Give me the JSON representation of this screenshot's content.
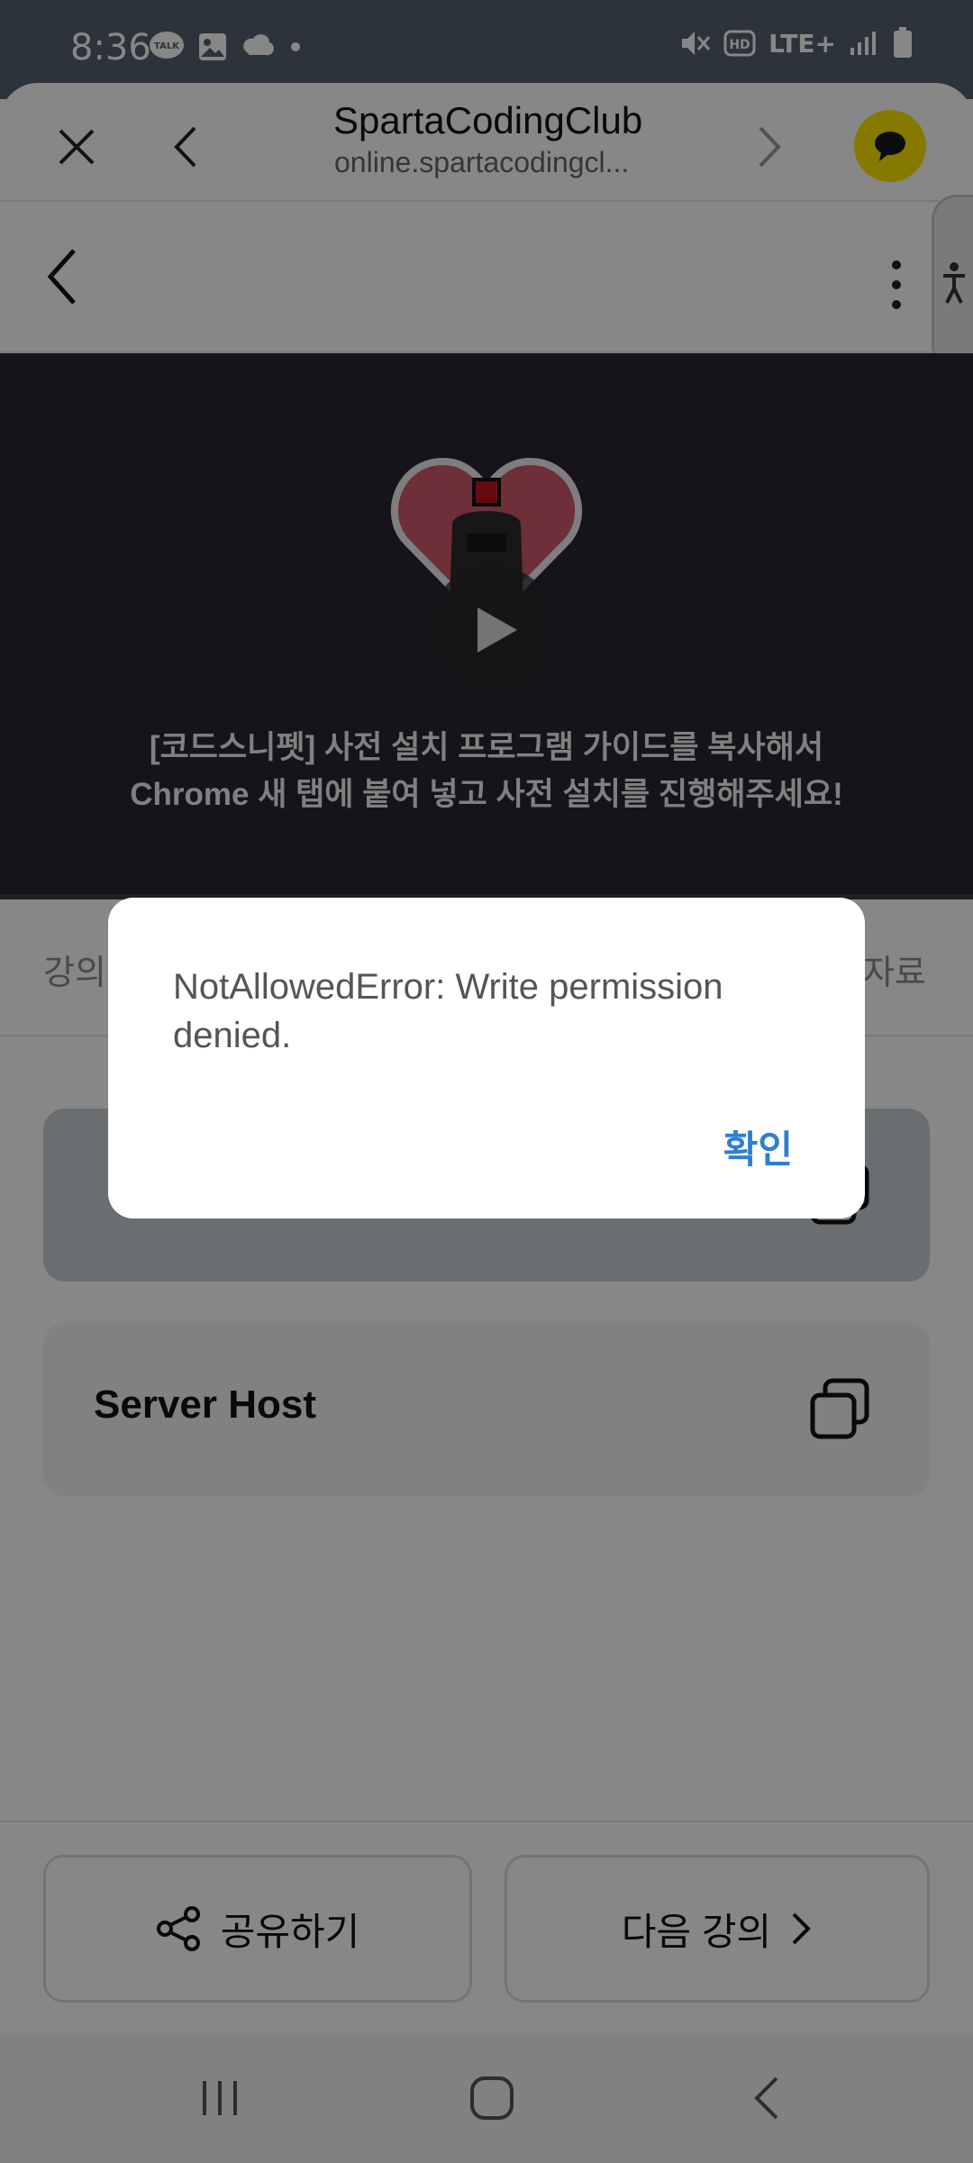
{
  "status_bar": {
    "time": "8:36",
    "left_icons": [
      "kakaotalk-icon",
      "gallery-icon",
      "threads-icon",
      "dot-icon"
    ],
    "right_icons": [
      "mute-icon",
      "hd-voice-icon",
      "lte-icon",
      "signal-icon",
      "battery-icon"
    ],
    "network": "LTE+"
  },
  "browser": {
    "title": "SpartaCodingClub",
    "url": "online.spartacodingcl..."
  },
  "video": {
    "caption": "[코드스니펫] 사전 설치 프로그램 가이드를 복사해서\nChrome 새 탭에 붙여 넣고 사전 설치를 진행해주세요!"
  },
  "tabs": {
    "left_partial": "강의",
    "right_partial": "자료"
  },
  "cards": [
    {
      "title": "",
      "icon": "copy-icon"
    },
    {
      "title": "Server Host",
      "icon": "copy-icon"
    }
  ],
  "bottom": {
    "share_label": "공유하기",
    "next_label": "다음 강의"
  },
  "dialog": {
    "message": "NotAllowedError: Write permission denied.",
    "confirm_label": "확인"
  },
  "colors": {
    "status_bar": "#536070",
    "kakao_yellow": "#fde500",
    "dialog_button": "#2d7fd3",
    "video_bg": "#2a2731"
  }
}
